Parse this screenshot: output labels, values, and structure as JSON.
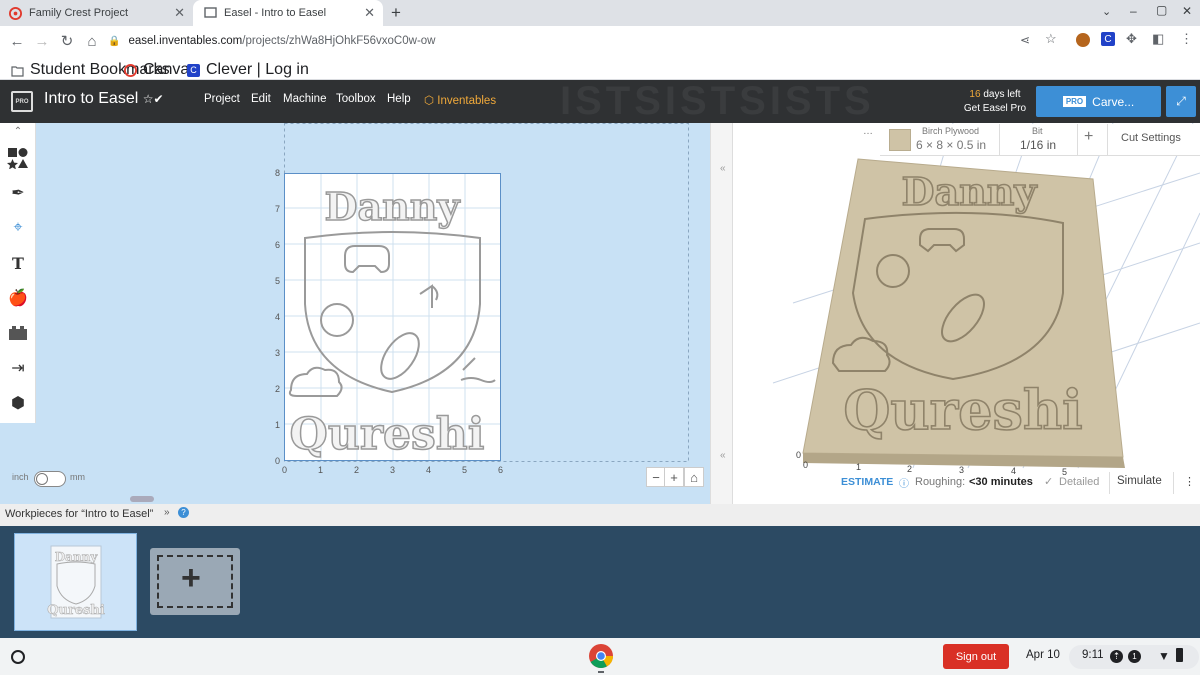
{
  "browser": {
    "tabs": [
      {
        "title": "Family Crest Project"
      },
      {
        "title": "Easel - Intro to Easel"
      }
    ],
    "url_host": "easel.inventables.com",
    "url_path": "/projects/zhWa8HjOhkF56vxoC0w-ow",
    "bookmarks": [
      "Student Bookmarks",
      "Canvas",
      "Clever | Log in"
    ]
  },
  "easel": {
    "logo_text": "PRO",
    "project_title": "Intro to Easel",
    "menus": [
      "Project",
      "Edit",
      "Machine",
      "Toolbox",
      "Help",
      "Inventables"
    ],
    "trial_days": "16",
    "trial_suffix": " days left",
    "trial_cta": "Get Easel Pro",
    "carve_badge": "PRO",
    "carve_label": "Carve..."
  },
  "canvas": {
    "y_ticks": [
      "8",
      "7",
      "6",
      "5",
      "4",
      "3",
      "2",
      "1",
      "0"
    ],
    "x_ticks": [
      "0",
      "1",
      "2",
      "3",
      "4",
      "5",
      "6"
    ],
    "unit_left": "inch",
    "unit_right": "mm",
    "design_top_text": "Danny",
    "design_bottom_text": "Qureshi"
  },
  "preview": {
    "material_label": "Birch Plywood",
    "material_size": "6 × 8 × 0.5 in",
    "bit_label": "Bit",
    "bit_size": "1/16 in",
    "cut_settings": "Cut Settings",
    "x_ticks": [
      "0",
      "1",
      "2",
      "3",
      "4",
      "5"
    ],
    "y_zero": "0",
    "estimate_label": "ESTIMATE",
    "roughing_label": "Roughing:",
    "roughing_value": "<30 minutes",
    "detailed_label": "Detailed",
    "simulate_label": "Simulate"
  },
  "workpieces": {
    "title": "Workpieces for “Intro to Easel”"
  },
  "taskbar": {
    "signout": "Sign out",
    "date": "Apr 10",
    "time": "9:11",
    "notification_count": "1"
  },
  "colors": {
    "carve_blue": "#3d8fd6",
    "easel_bar": "#2f3133",
    "canvas_bg": "#c8e1f5",
    "wood": "#cfc3a6",
    "workpiece_bg": "#2c4a63",
    "signout_red": "#d93025"
  }
}
